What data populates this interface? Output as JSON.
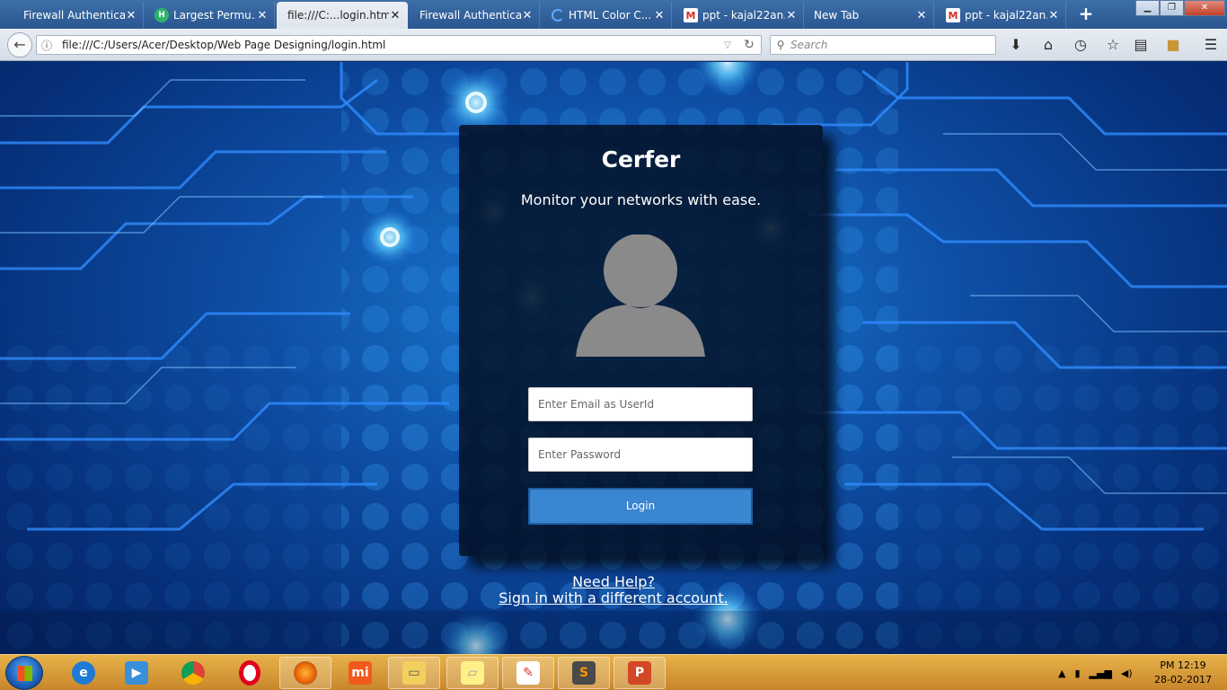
{
  "browser": {
    "tabs": [
      {
        "title": "Firewall Authentica...",
        "icon": "none",
        "active": false
      },
      {
        "title": "Largest Permu...",
        "icon": "h-icon",
        "active": false
      },
      {
        "title": "file:///C:...login.html",
        "icon": "none",
        "active": true
      },
      {
        "title": "Firewall Authentica...",
        "icon": "none",
        "active": false
      },
      {
        "title": "HTML Color C...",
        "icon": "loading-icon",
        "active": false
      },
      {
        "title": "ppt - kajal22an...",
        "icon": "gmail-icon",
        "active": false
      },
      {
        "title": "New Tab",
        "icon": "none",
        "active": false
      },
      {
        "title": "ppt - kajal22an...",
        "icon": "gmail-icon",
        "active": false
      }
    ],
    "url": "file:///C:/Users/Acer/Desktop/Web Page Designing/login.html",
    "search_placeholder": "Search"
  },
  "login": {
    "title": "Cerfer",
    "subtitle": "Monitor your networks with ease.",
    "email_placeholder": "Enter Email as UserId",
    "password_placeholder": "Enter Password",
    "login_label": "Login",
    "need_help": "Need Help?",
    "different_account": "Sign in with a different account."
  },
  "taskbar": {
    "apps": [
      "internet-explorer-icon",
      "media-player-icon",
      "chrome-icon",
      "opera-icon",
      "firefox-icon",
      "mi-icon",
      "file-explorer-icon",
      "sticky-notes-icon",
      "paint-icon",
      "sublime-text-icon",
      "powerpoint-icon"
    ],
    "time": "PM 12:19",
    "date": "28-02-2017"
  },
  "colors": {
    "accent_button": "#3a86d0",
    "background": "#0e4fa6",
    "card": "#020c1e"
  }
}
